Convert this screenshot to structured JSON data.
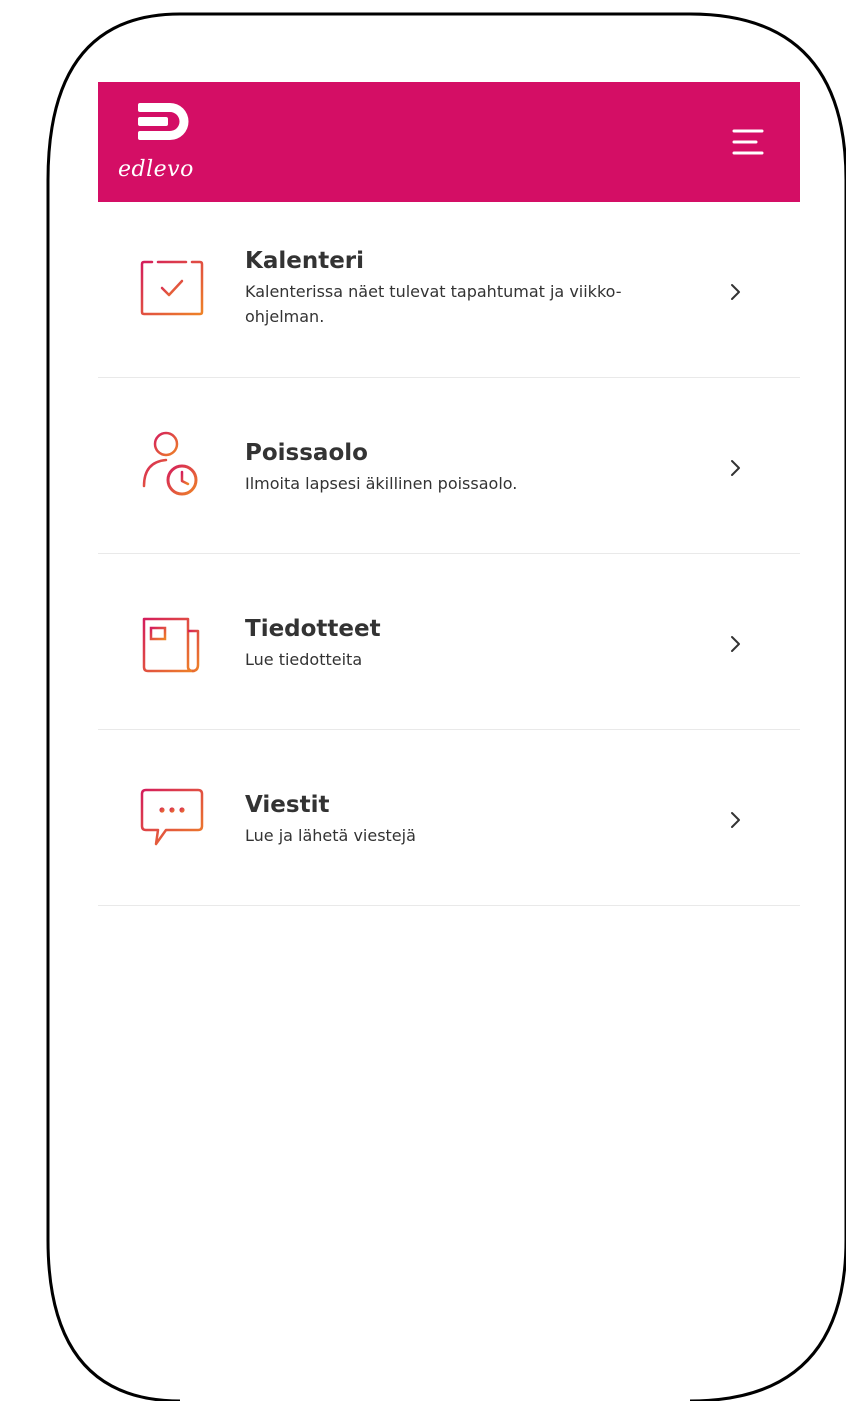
{
  "app": {
    "logo_text": "edlevo",
    "brand_color": "#d40e65",
    "icon_gradient": [
      "#d41d5c",
      "#ee8227"
    ]
  },
  "header": {
    "menu_icon": "hamburger-menu-icon"
  },
  "menu": {
    "items": [
      {
        "title": "Kalenteri",
        "description": "Kalenterissa näet tulevat tapahtumat ja viikko-ohjelman.",
        "icon": "calendar-check-icon"
      },
      {
        "title": "Poissaolo",
        "description": "Ilmoita lapsesi äkillinen poissaolo.",
        "icon": "person-clock-icon"
      },
      {
        "title": "Tiedotteet",
        "description": "Lue tiedotteita",
        "icon": "newspaper-icon"
      },
      {
        "title": "Viestit",
        "description": "Lue ja lähetä viestejä",
        "icon": "chat-bubble-icon"
      }
    ],
    "chevron_icon": "chevron-right-icon"
  }
}
